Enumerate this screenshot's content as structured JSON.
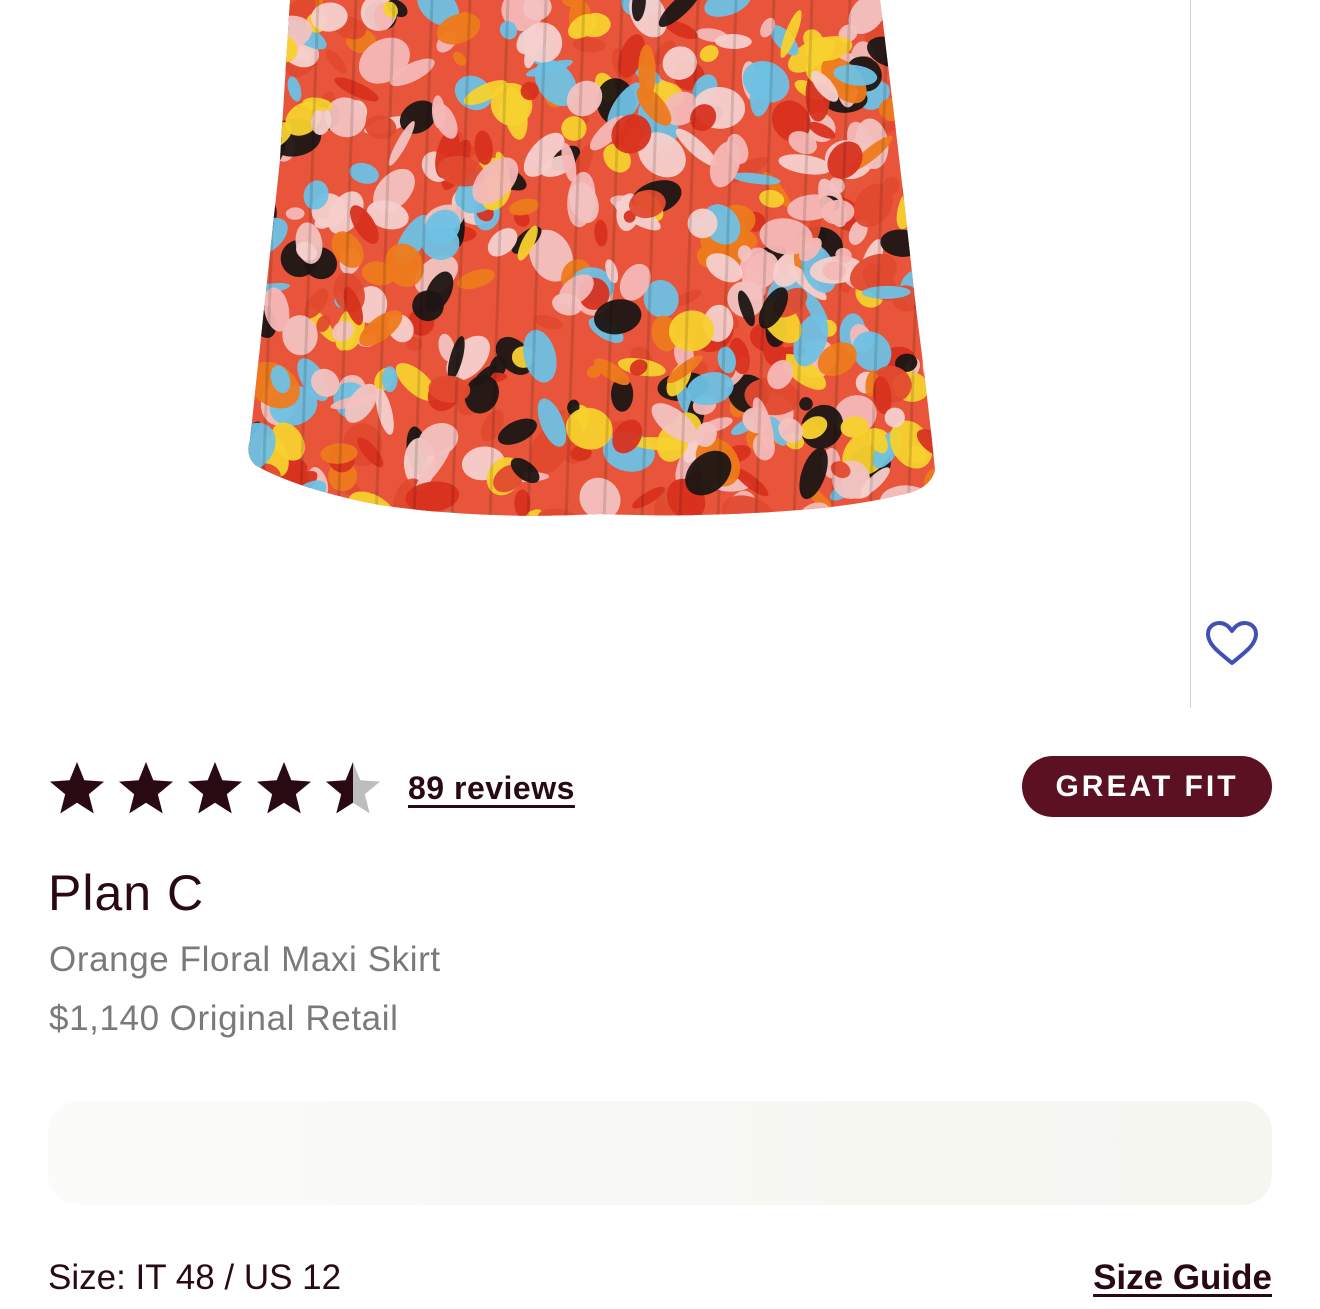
{
  "product": {
    "brand": "Plan C",
    "name": "Orange Floral Maxi Skirt",
    "retail_price": "$1,140",
    "retail_label": "Original Retail",
    "image_icon": "floral-skirt-photo"
  },
  "rating": {
    "value": 4.5,
    "max": 5,
    "reviews_label": "89 reviews"
  },
  "fit_badge": {
    "label": "GREAT FIT",
    "color": "#5c1123"
  },
  "favorite": {
    "icon": "heart-outline-icon",
    "color": "#3f51b5"
  },
  "size": {
    "label": "Size: IT 48 / US 12",
    "guide_label": "Size Guide"
  },
  "colors": {
    "text_primary": "#2a0a12",
    "text_secondary": "#7a7a7a",
    "star_filled": "#2a0a12",
    "star_empty": "#bdbdbd"
  }
}
